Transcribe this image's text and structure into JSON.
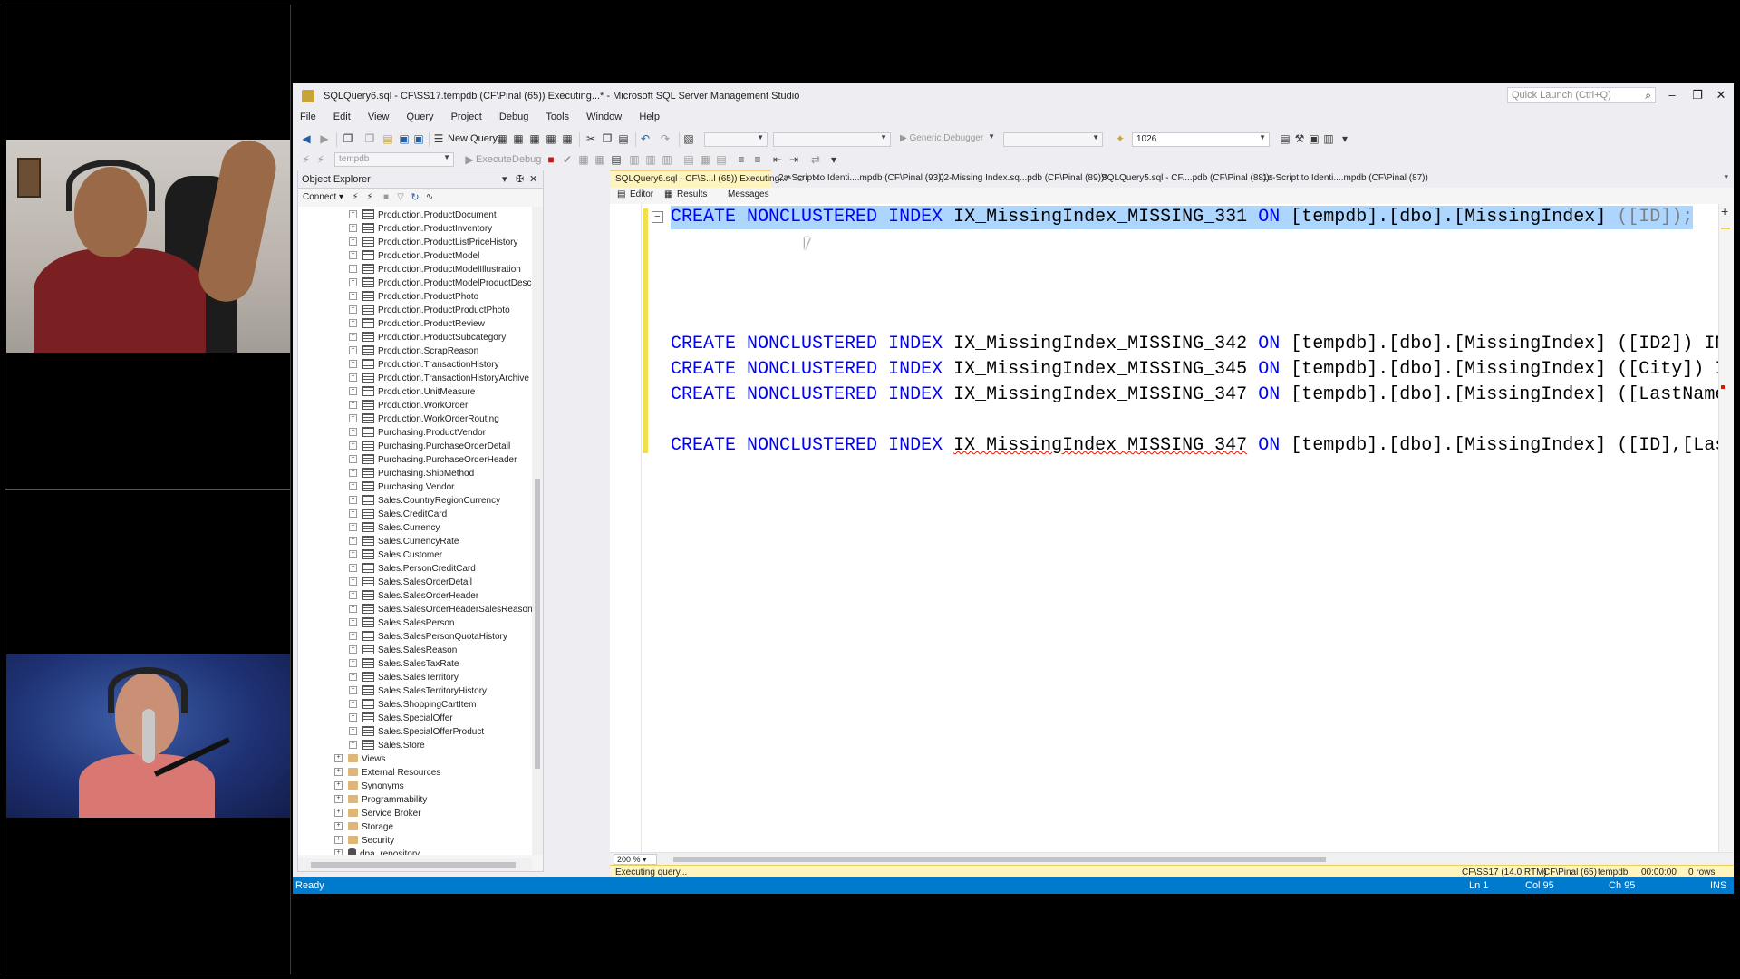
{
  "window": {
    "title": "SQLQuery6.sql - CF\\SS17.tempdb (CF\\Pinal (65)) Executing...* - Microsoft SQL Server Management Studio",
    "quick_launch_placeholder": "Quick Launch (Ctrl+Q)",
    "controls": [
      "–",
      "❐",
      "✕"
    ]
  },
  "menu": [
    "File",
    "Edit",
    "View",
    "Query",
    "Project",
    "Debug",
    "Tools",
    "Window",
    "Help"
  ],
  "toolbar": {
    "new_query": "New Query",
    "debugger": "Generic Debugger",
    "search_value": "1026",
    "database": "tempdb",
    "execute": "Execute",
    "debug": "Debug"
  },
  "object_explorer": {
    "title": "Object Explorer",
    "connect": "Connect",
    "tables": [
      "Production.ProductDocument",
      "Production.ProductInventory",
      "Production.ProductListPriceHistory",
      "Production.ProductModel",
      "Production.ProductModelIllustration",
      "Production.ProductModelProductDescriptionCultu",
      "Production.ProductPhoto",
      "Production.ProductProductPhoto",
      "Production.ProductReview",
      "Production.ProductSubcategory",
      "Production.ScrapReason",
      "Production.TransactionHistory",
      "Production.TransactionHistoryArchive",
      "Production.UnitMeasure",
      "Production.WorkOrder",
      "Production.WorkOrderRouting",
      "Purchasing.ProductVendor",
      "Purchasing.PurchaseOrderDetail",
      "Purchasing.PurchaseOrderHeader",
      "Purchasing.ShipMethod",
      "Purchasing.Vendor",
      "Sales.CountryRegionCurrency",
      "Sales.CreditCard",
      "Sales.Currency",
      "Sales.CurrencyRate",
      "Sales.Customer",
      "Sales.PersonCreditCard",
      "Sales.SalesOrderDetail",
      "Sales.SalesOrderHeader",
      "Sales.SalesOrderHeaderSalesReason",
      "Sales.SalesPerson",
      "Sales.SalesPersonQuotaHistory",
      "Sales.SalesReason",
      "Sales.SalesTaxRate",
      "Sales.SalesTerritory",
      "Sales.SalesTerritoryHistory",
      "Sales.ShoppingCartItem",
      "Sales.SpecialOffer",
      "Sales.SpecialOfferProduct",
      "Sales.Store"
    ],
    "folders": [
      "Views",
      "External Resources",
      "Synonyms",
      "Programmability",
      "Service Broker",
      "Storage",
      "Security"
    ],
    "database_node": "dpa_repository"
  },
  "tabs": [
    {
      "label": "SQLQuery6.sql - CF\\S...l (65)) Executing...*",
      "active": true
    },
    {
      "label": "2a-Script to Identi....mpdb (CF\\Pinal (93))",
      "active": false
    },
    {
      "label": "02-Missing Index.sq...pdb (CF\\Pinal (89))*",
      "active": false
    },
    {
      "label": "SQLQuery5.sql - CF....pdb (CF\\Pinal (88))*",
      "active": false
    },
    {
      "label": "1a-Script to Identi....mpdb (CF\\Pinal (87))",
      "active": false
    }
  ],
  "subtabs": [
    "Editor",
    "Results",
    "Messages"
  ],
  "code": {
    "kw_create": "CREATE",
    "kw_nonclustered": "NONCLUSTERED",
    "kw_index": "INDEX",
    "kw_on": "ON",
    "table_ref": "[tempdb].[dbo].[MissingIndex]",
    "line1": {
      "name": "IX_MissingIndex_MISSING_331",
      "cols": "([ID]);"
    },
    "line2": {
      "name": "IX_MissingIndex_MISSING_342",
      "cols": "([ID2]) IN"
    },
    "line3": {
      "name": "IX_MissingIndex_MISSING_345",
      "cols": "([City]) I"
    },
    "line4": {
      "name": "IX_MissingIndex_MISSING_347",
      "cols": "([LastName"
    },
    "line5": {
      "name": "IX_MissingIndex_MISSING_347",
      "cols": "([ID],[Las"
    }
  },
  "zoom": "200 %",
  "query_status": {
    "message": "Executing query...",
    "server": "CF\\SS17 (14.0 RTM)",
    "user": "CF\\Pinal (65)",
    "database": "tempdb",
    "elapsed": "00:00:00",
    "rows": "0 rows"
  },
  "statusbar": {
    "state": "Ready",
    "ln": "Ln 1",
    "col": "Col 95",
    "ch": "Ch 95",
    "mode": "INS"
  },
  "colors": {
    "accent": "#007acc",
    "selection": "#add6ff",
    "keyword": "#0000ff",
    "executing_bar": "#fdf4bf"
  }
}
